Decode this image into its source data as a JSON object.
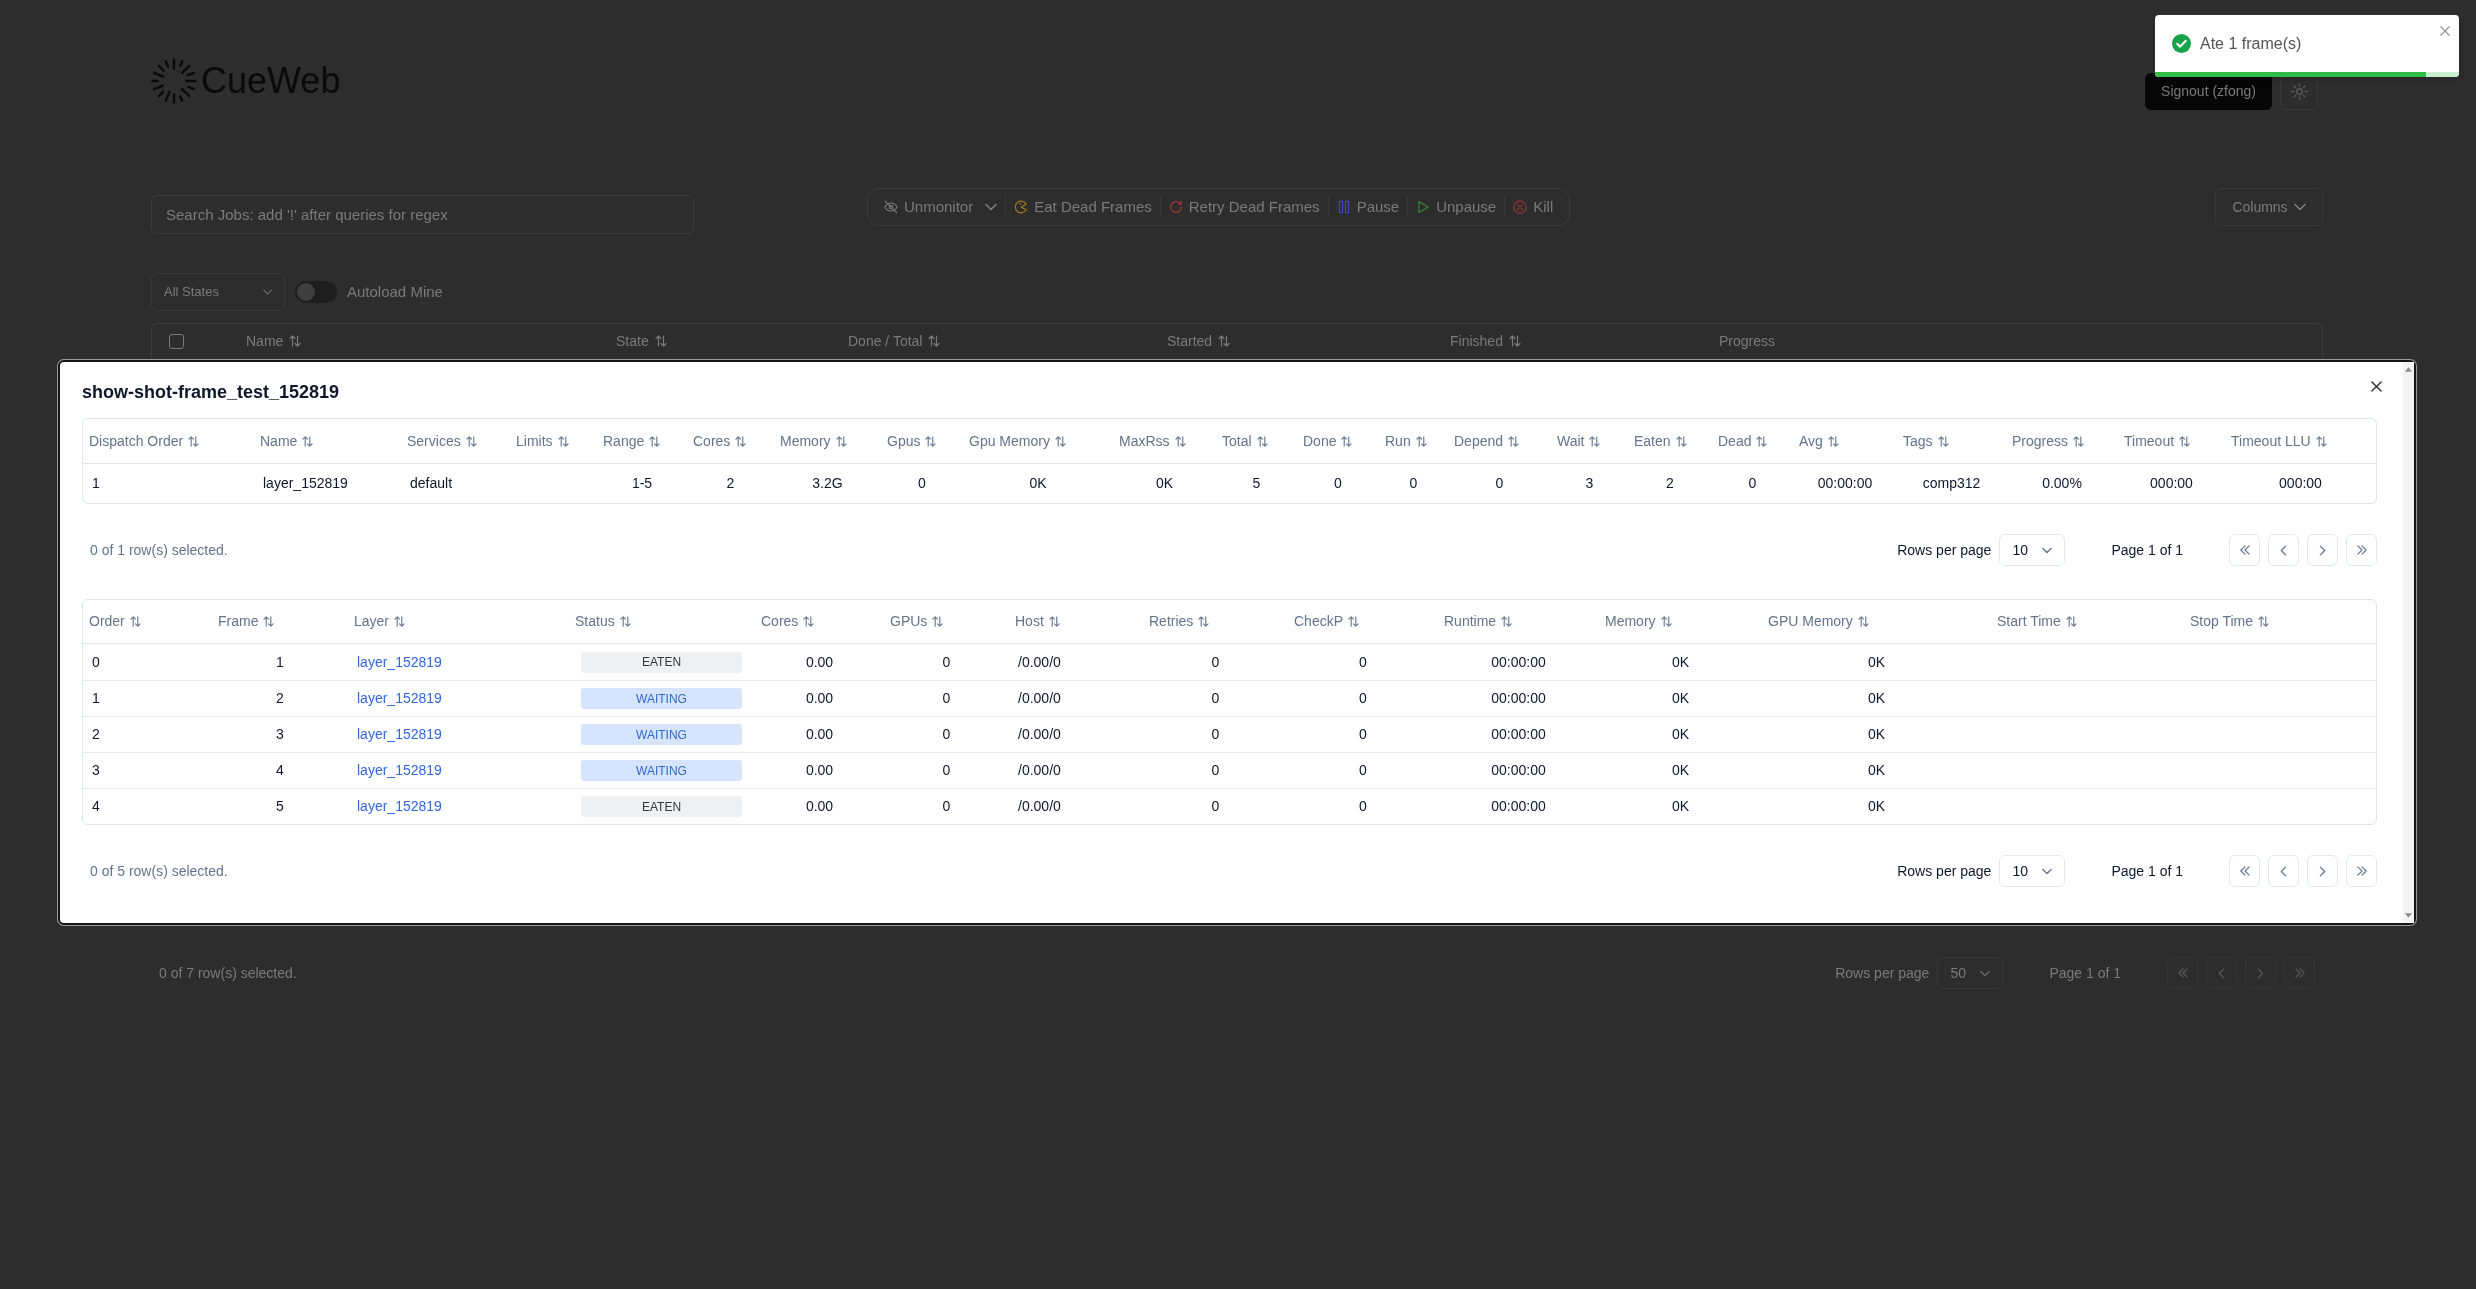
{
  "header": {
    "logo": "CueWeb",
    "signout_button": "Signout (zfong)"
  },
  "toast": {
    "message": "Ate 1 frame(s)",
    "level": 0.89
  },
  "search": {
    "placeholder": "Search Jobs: add '!' after queries for regex"
  },
  "toolbar": [
    {
      "label": "Unmonitor",
      "kind": "dropdown"
    },
    {
      "label": "Eat Dead Frames",
      "kind": "action"
    },
    {
      "label": "Retry Dead Frames",
      "kind": "action"
    },
    {
      "label": "Pause",
      "kind": "action"
    },
    {
      "label": "Unpause",
      "kind": "action"
    },
    {
      "label": "Kill",
      "kind": "action"
    }
  ],
  "columns_button": "Columns",
  "state_filter": "All States",
  "autoload": {
    "label": "Autoload Mine",
    "on": false
  },
  "jobs_table": {
    "select_all_checked": false,
    "columns": [
      {
        "label": "Name",
        "sortable": true
      },
      {
        "label": "State",
        "sortable": true
      },
      {
        "label": "Done / Total",
        "sortable": true
      },
      {
        "label": "Started",
        "sortable": true
      },
      {
        "label": "Finished",
        "sortable": true
      },
      {
        "label": "Progress",
        "sortable": false
      }
    ],
    "footer": {
      "selected": "0 of 7 row(s) selected.",
      "rows_per_page_label": "Rows per page",
      "rows_per_page": "50",
      "page": "Page 1 of 1"
    }
  },
  "dialog": {
    "title": "show-shot-frame_test_152819",
    "layers_table": {
      "columns": [
        "Dispatch Order",
        "Name",
        "Services",
        "Limits",
        "Range",
        "Cores",
        "Memory",
        "Gpus",
        "Gpu Memory",
        "MaxRss",
        "Total",
        "Done",
        "Run",
        "Depend",
        "Wait",
        "Eaten",
        "Dead",
        "Avg",
        "Tags",
        "Progress",
        "Timeout",
        "Timeout LLU"
      ],
      "rows": [
        {
          "dispatch_order": "1",
          "name": "layer_152819",
          "services": "default",
          "range": "1-5",
          "cores": "2",
          "memory": "3.2G",
          "gpus": "0",
          "gpu_memory": "0K",
          "max_rss": "0K",
          "total": "5",
          "done": "0",
          "run": "0",
          "depend": "0",
          "wait": "3",
          "eaten": "2",
          "dead": "0",
          "avg": "00:00:00",
          "tags": "comp312",
          "progress": "0.00%",
          "timeout": "000:00",
          "timeout_llu": "000:00"
        }
      ],
      "footer": {
        "selected": "0 of 1 row(s) selected.",
        "rows_per_page_label": "Rows per page",
        "rows_per_page": "10",
        "page": "Page 1 of 1"
      }
    },
    "frames_table": {
      "columns": [
        "Order",
        "Frame",
        "Layer",
        "Status",
        "Cores",
        "GPUs",
        "Host",
        "Retries",
        "CheckP",
        "Runtime",
        "Memory",
        "GPU Memory",
        "Start Time",
        "Stop Time"
      ],
      "rows": [
        {
          "order": "0",
          "frame": "1",
          "layer": "layer_152819",
          "status": "EATEN",
          "color": "#eef0f3",
          "cores": "0.00",
          "gpus": "0",
          "host": "/0.00/0",
          "retries": "0",
          "checkp": "0",
          "runtime": "00:00:00",
          "memory": "0K",
          "gpu_memory": "0K"
        },
        {
          "order": "1",
          "frame": "2",
          "layer": "layer_152819",
          "status": "WAITING",
          "color": "#d6e4fd",
          "cores": "0.00",
          "gpus": "0",
          "host": "/0.00/0",
          "retries": "0",
          "checkp": "0",
          "runtime": "00:00:00",
          "memory": "0K",
          "gpu_memory": "0K"
        },
        {
          "order": "2",
          "frame": "3",
          "layer": "layer_152819",
          "status": "WAITING",
          "color": "#d6e4fd",
          "cores": "0.00",
          "gpus": "0",
          "host": "/0.00/0",
          "retries": "0",
          "checkp": "0",
          "runtime": "00:00:00",
          "memory": "0K",
          "gpu_memory": "0K"
        },
        {
          "order": "3",
          "frame": "4",
          "layer": "layer_152819",
          "status": "WAITING",
          "color": "#d6e4fd",
          "cores": "0.00",
          "gpus": "0",
          "host": "/0.00/0",
          "retries": "0",
          "checkp": "0",
          "runtime": "00:00:00",
          "memory": "0K",
          "gpu_memory": "0K"
        },
        {
          "order": "4",
          "frame": "5",
          "layer": "layer_152819",
          "status": "EATEN",
          "color": "#eef0f3",
          "cores": "0.00",
          "gpus": "0",
          "host": "/0.00/0",
          "retries": "0",
          "checkp": "0",
          "runtime": "00:00:00",
          "memory": "0K",
          "gpu_memory": "0K"
        }
      ],
      "footer": {
        "selected": "0 of 5 row(s) selected.",
        "rows_per_page_label": "Rows per page",
        "rows_per_page": "10",
        "page": "Page 1 of 1"
      }
    }
  }
}
